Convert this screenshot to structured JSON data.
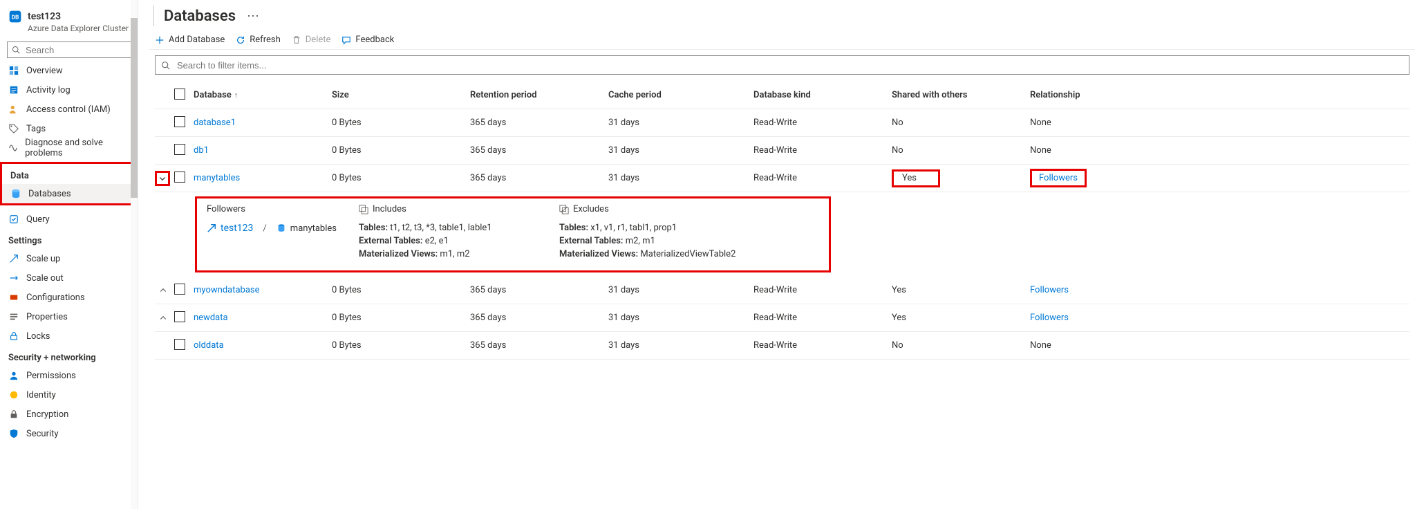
{
  "cluster": {
    "name": "test123",
    "kind": "Azure Data Explorer Cluster"
  },
  "sidebar": {
    "search_placeholder": "Search",
    "nav": {
      "overview": "Overview",
      "activity_log": "Activity log",
      "access_control": "Access control (IAM)",
      "tags": "Tags",
      "diagnose": "Diagnose and solve problems"
    },
    "sections": {
      "data": {
        "title": "Data",
        "databases": "Databases",
        "query": "Query"
      },
      "settings": {
        "title": "Settings",
        "scale_up": "Scale up",
        "scale_out": "Scale out",
        "configurations": "Configurations",
        "properties": "Properties",
        "locks": "Locks"
      },
      "sec_net": {
        "title": "Security + networking",
        "permissions": "Permissions",
        "identity": "Identity",
        "encryption": "Encryption",
        "security": "Security"
      }
    }
  },
  "page": {
    "title": "Databases",
    "commands": {
      "add": "Add Database",
      "refresh": "Refresh",
      "delete": "Delete",
      "feedback": "Feedback"
    },
    "filter_placeholder": "Search to filter items..."
  },
  "table": {
    "headers": {
      "database": "Database",
      "size": "Size",
      "retention": "Retention period",
      "cache": "Cache period",
      "kind": "Database kind",
      "shared": "Shared with others",
      "relationship": "Relationship"
    },
    "rows": [
      {
        "name": "database1",
        "size": "0 Bytes",
        "retention": "365 days",
        "cache": "31 days",
        "kind": "Read-Write",
        "shared": "No",
        "relationship": "None",
        "rel_link": false,
        "expand": "",
        "shared_boxed": false
      },
      {
        "name": "db1",
        "size": "0 Bytes",
        "retention": "365 days",
        "cache": "31 days",
        "kind": "Read-Write",
        "shared": "No",
        "relationship": "None",
        "rel_link": false,
        "expand": "",
        "shared_boxed": false
      },
      {
        "name": "manytables",
        "size": "0 Bytes",
        "retention": "365 days",
        "cache": "31 days",
        "kind": "Read-Write",
        "shared": "Yes",
        "relationship": "Followers",
        "rel_link": true,
        "expand": "down",
        "shared_boxed": true
      },
      {
        "name": "myowndatabase",
        "size": "0 Bytes",
        "retention": "365 days",
        "cache": "31 days",
        "kind": "Read-Write",
        "shared": "Yes",
        "relationship": "Followers",
        "rel_link": true,
        "expand": "up",
        "shared_boxed": false
      },
      {
        "name": "newdata",
        "size": "0 Bytes",
        "retention": "365 days",
        "cache": "31 days",
        "kind": "Read-Write",
        "shared": "Yes",
        "relationship": "Followers",
        "rel_link": true,
        "expand": "up",
        "shared_boxed": false
      },
      {
        "name": "olddata",
        "size": "0 Bytes",
        "retention": "365 days",
        "cache": "31 days",
        "kind": "Read-Write",
        "shared": "No",
        "relationship": "None",
        "rel_link": false,
        "expand": "",
        "shared_boxed": false
      }
    ]
  },
  "detail": {
    "followers_header": "Followers",
    "includes_header": "Includes",
    "excludes_header": "Excludes",
    "breadcrumb_cluster": "test123",
    "breadcrumb_db": "manytables",
    "labels": {
      "tables": "Tables:",
      "ext_tables": "External Tables:",
      "mat_views": "Materialized Views:"
    },
    "includes": {
      "tables": "t1, t2, t3, *3, table1, lable1",
      "ext_tables": "e2, e1",
      "mat_views": "m1, m2"
    },
    "excludes": {
      "tables": "x1, v1, r1, tabl1, prop1",
      "ext_tables": "m2, m1",
      "mat_views": "MaterializedViewTable2"
    }
  }
}
